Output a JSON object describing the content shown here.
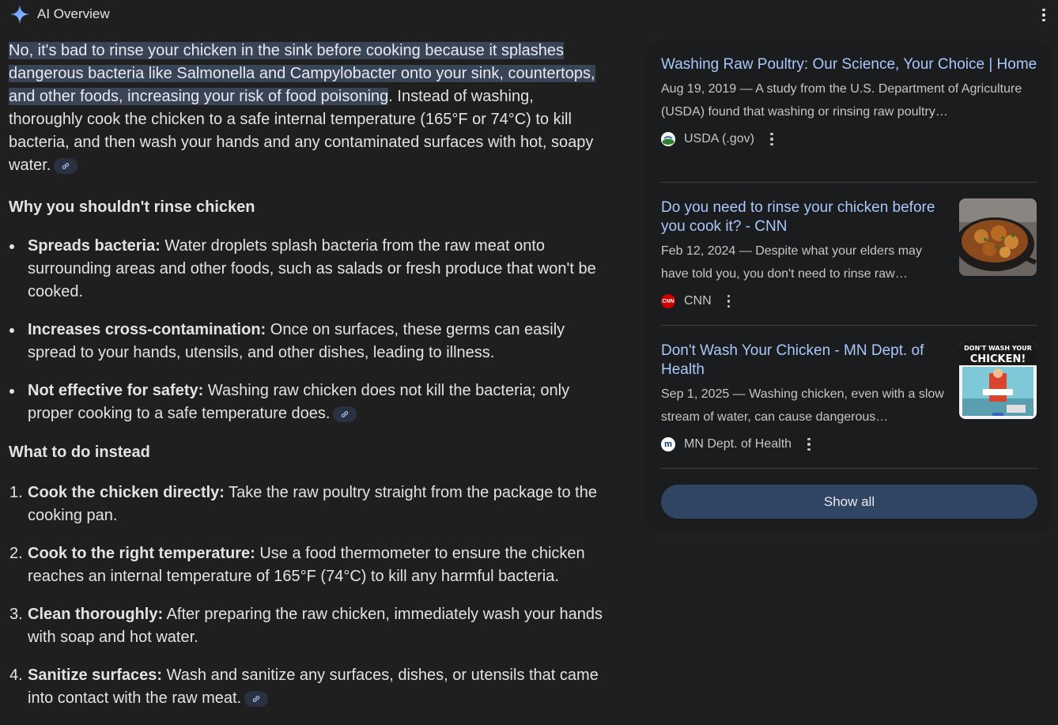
{
  "header": {
    "title": "AI Overview",
    "sparkle_icon": "sparkle-icon",
    "menu_icon": "more-vert-icon"
  },
  "answer": {
    "highlighted": "No, it's bad to rinse your chicken in the sink before cooking because it splashes dangerous bacteria like Salmonella and Campylobacter onto your sink, countertops, and other foods, increasing your risk of food poisoning",
    "rest": ". Instead of washing, thoroughly cook the chicken to a safe internal temperature (165°F or 74°C) to kill bacteria, and then wash your hands and any contaminated surfaces with hot, soapy water."
  },
  "why": {
    "heading": "Why you shouldn't rinse chicken",
    "items": [
      {
        "bold": "Spreads bacteria:",
        "text": " Water droplets splash bacteria from the raw meat onto surrounding areas and other foods, such as salads or fresh produce that won't be cooked."
      },
      {
        "bold": "Increases cross-contamination:",
        "text": " Once on surfaces, these germs can easily spread to your hands, utensils, and other dishes, leading to illness."
      },
      {
        "bold": "Not effective for safety:",
        "text": " Washing raw chicken does not kill the bacteria; only proper cooking to a safe temperature does."
      }
    ]
  },
  "what": {
    "heading": "What to do instead",
    "items": [
      {
        "num": "1.",
        "bold": "Cook the chicken directly:",
        "text": " Take the raw poultry straight from the package to the cooking pan."
      },
      {
        "num": "2.",
        "bold": "Cook to the right temperature:",
        "text": " Use a food thermometer to ensure the chicken reaches an internal temperature of 165°F (74°C) to kill any harmful bacteria."
      },
      {
        "num": "3.",
        "bold": "Clean thoroughly:",
        "text": " After preparing the raw chicken, immediately wash your hands with soap and hot water."
      },
      {
        "num": "4.",
        "bold": "Sanitize surfaces:",
        "text": " Wash and sanitize any surfaces, dishes, or utensils that came into contact with the raw meat."
      }
    ]
  },
  "sources": [
    {
      "title": "Washing Raw Poultry: Our Science, Your Choice | Home",
      "snippet": "Aug 19, 2019 — A study from the U.S. Department of Agriculture (USDA) found that washing or rinsing raw poultry…",
      "site": "USDA (.gov)",
      "favicon": "usda-favicon-icon"
    },
    {
      "title": "Do you need to rinse your chicken before you cook it? - CNN",
      "snippet": "Feb 12, 2024 — Despite what your elders may have told you, you don't need to rinse raw…",
      "site": "CNN",
      "favicon": "cnn-favicon-icon",
      "favicon_text": "CNN",
      "thumbnail": "cooked-chicken-skillet-thumbnail"
    },
    {
      "title": "Don't Wash Your Chicken - MN Dept. of Health",
      "snippet": "Sep 1, 2025 — Washing chicken, even with a slow stream of water, can cause dangerous…",
      "site": "MN Dept. of Health",
      "favicon": "mn-health-favicon-icon",
      "favicon_text": "m",
      "thumbnail": "dont-wash-your-chicken-poster-thumbnail",
      "thumbnail_text_1": "DON'T WASH YOUR",
      "thumbnail_text_2": "CHICKEN!"
    }
  ],
  "show_all": "Show all",
  "colors": {
    "background": "#1f1f1f",
    "panel": "#1b1c1d",
    "link": "#a8c7fa",
    "highlight": "#394457",
    "button": "#304563"
  }
}
